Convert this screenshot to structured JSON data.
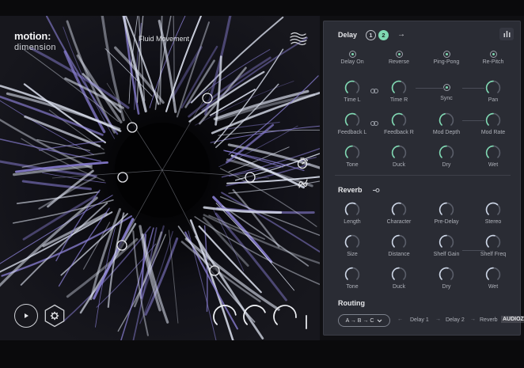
{
  "brand": {
    "line1": "motion:",
    "line2": "dimension"
  },
  "preset_name": "Fluid Movement",
  "icons": {
    "waves": "waves-icon",
    "timer": "timer-icon",
    "curve": "curve-icon",
    "play": "play-icon",
    "settings": "gear-icon",
    "bars": "bars-icon",
    "link": "link-icon",
    "arrow": "arrow-right-icon"
  },
  "colors": {
    "accent": "#7fd9b2",
    "panel": "#2a2c34",
    "knob_track": "#5a5e69",
    "knob_arc": "#cdd6e6",
    "purple_streak": "#8a7fd4"
  },
  "macro_knobs": [
    0.8,
    0.75,
    0.85
  ],
  "delay": {
    "title": "Delay",
    "tabs": [
      "1",
      "2"
    ],
    "active_tab": "2",
    "toggles": [
      {
        "label": "Delay On"
      },
      {
        "label": "Reverse"
      },
      {
        "label": "Ping-Pong"
      },
      {
        "label": "Re-Pitch"
      }
    ],
    "rows": [
      [
        {
          "label": "Time L",
          "value": 0.55
        },
        {
          "label": "Time R",
          "value": 0.55
        },
        {
          "label": "Sync",
          "toggle": true
        },
        {
          "label": "Pan",
          "value": 0.5
        }
      ],
      [
        {
          "label": "Feedback L",
          "value": 0.6
        },
        {
          "label": "Feedback R",
          "value": 0.6
        },
        {
          "label": "Mod Depth",
          "value": 0.45
        },
        {
          "label": "Mod Rate",
          "value": 0.5
        }
      ],
      [
        {
          "label": "Tone",
          "value": 0.5
        },
        {
          "label": "Duck",
          "value": 0.5
        },
        {
          "label": "Dry",
          "value": 0.5
        },
        {
          "label": "Wet",
          "value": 0.5
        }
      ]
    ]
  },
  "reverb": {
    "title": "Reverb",
    "rows": [
      [
        {
          "label": "Length",
          "value": 0.6
        },
        {
          "label": "Character",
          "value": 0.55
        },
        {
          "label": "Pre-Delay",
          "value": 0.5
        },
        {
          "label": "Stereo",
          "value": 0.65
        }
      ],
      [
        {
          "label": "Size",
          "value": 0.45
        },
        {
          "label": "Distance",
          "value": 0.5
        },
        {
          "label": "Shelf Gain",
          "value": 0.5
        },
        {
          "label": "Shelf Freq",
          "value": 0.55
        }
      ],
      [
        {
          "label": "Tone",
          "value": 0.5
        },
        {
          "label": "Duck",
          "value": 0.5
        },
        {
          "label": "Dry",
          "value": 0.55
        },
        {
          "label": "Wet",
          "value": 0.5
        }
      ]
    ]
  },
  "routing": {
    "title": "Routing",
    "selected": "A → B → C",
    "chain": [
      "Delay 1",
      "Delay 2",
      "Reverb"
    ]
  },
  "watermark": "AUDIOZ"
}
